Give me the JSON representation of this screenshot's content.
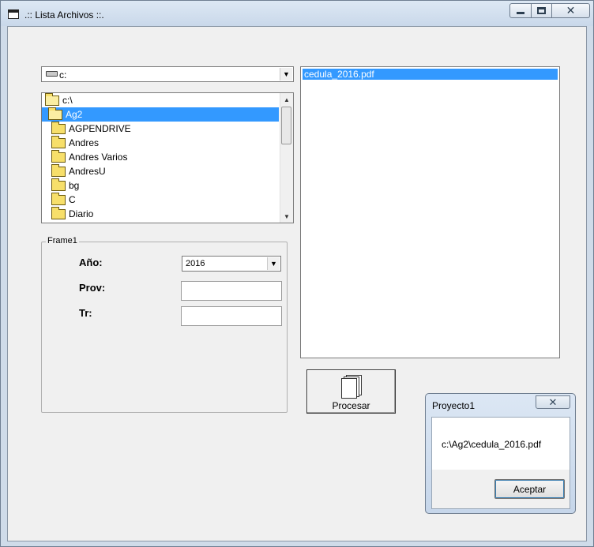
{
  "window": {
    "title": ".:: Lista Archivos ::.",
    "close_glyph": "✕"
  },
  "drive": {
    "value": "c:",
    "arrow": "▼"
  },
  "directories": {
    "items": [
      {
        "label": "c:\\",
        "selected": false
      },
      {
        "label": "Ag2",
        "selected": true
      },
      {
        "label": "AGPENDRIVE",
        "selected": false
      },
      {
        "label": "Andres",
        "selected": false
      },
      {
        "label": "Andres Varios",
        "selected": false
      },
      {
        "label": "AndresU",
        "selected": false
      },
      {
        "label": "bg",
        "selected": false
      },
      {
        "label": "C",
        "selected": false
      },
      {
        "label": "Diario",
        "selected": false
      }
    ],
    "scroll_up": "▲",
    "scroll_down": "▼"
  },
  "frame": {
    "caption": "Frame1",
    "anio_label": "Año:",
    "anio_value": "2016",
    "anio_arrow": "▼",
    "prov_label": "Prov:",
    "prov_value": "",
    "tr_label": "Tr:",
    "tr_value": ""
  },
  "files": {
    "items": [
      "cedula_2016.pdf"
    ]
  },
  "procesar": {
    "label": "Procesar"
  },
  "message_box": {
    "title": "Proyecto1",
    "close_glyph": "✕",
    "text": "c:\\Ag2\\cedula_2016.pdf",
    "ok_label": "Aceptar"
  },
  "colors": {
    "selection": "#3399ff",
    "window_frame": "#cfdbe9",
    "client": "#f0f0f0"
  }
}
